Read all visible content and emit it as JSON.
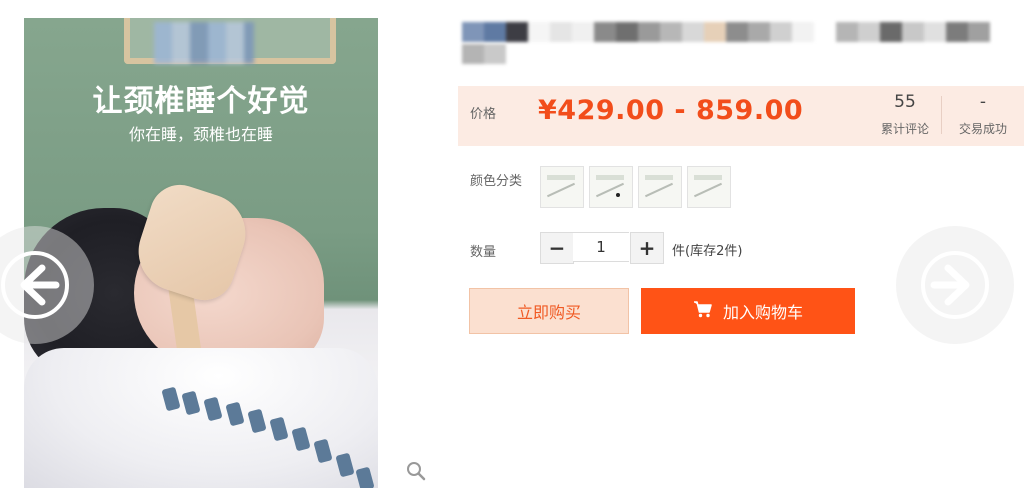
{
  "image": {
    "headline": "让颈椎睡个好觉",
    "subline": "你在睡，颈椎也在睡"
  },
  "price_section": {
    "label": "价格",
    "price_range": "¥429.00 - 859.00",
    "reviews_count": "55",
    "reviews_label": "累计评论",
    "sales_value": "-",
    "sales_label": "交易成功"
  },
  "color_option": {
    "label": "颜色分类"
  },
  "quantity": {
    "label": "数量",
    "minus": "−",
    "plus": "+",
    "value": "1",
    "stock": "件(库存2件)"
  },
  "actions": {
    "buy_now": "立即购买",
    "add_to_cart": "加入购物车"
  },
  "colors": {
    "accent": "#ff5316",
    "price": "#f24d1b",
    "price_bg": "#fcebe3"
  },
  "icons": [
    "arrow-left-icon",
    "arrow-right-icon",
    "zoom-icon",
    "cart-icon"
  ]
}
